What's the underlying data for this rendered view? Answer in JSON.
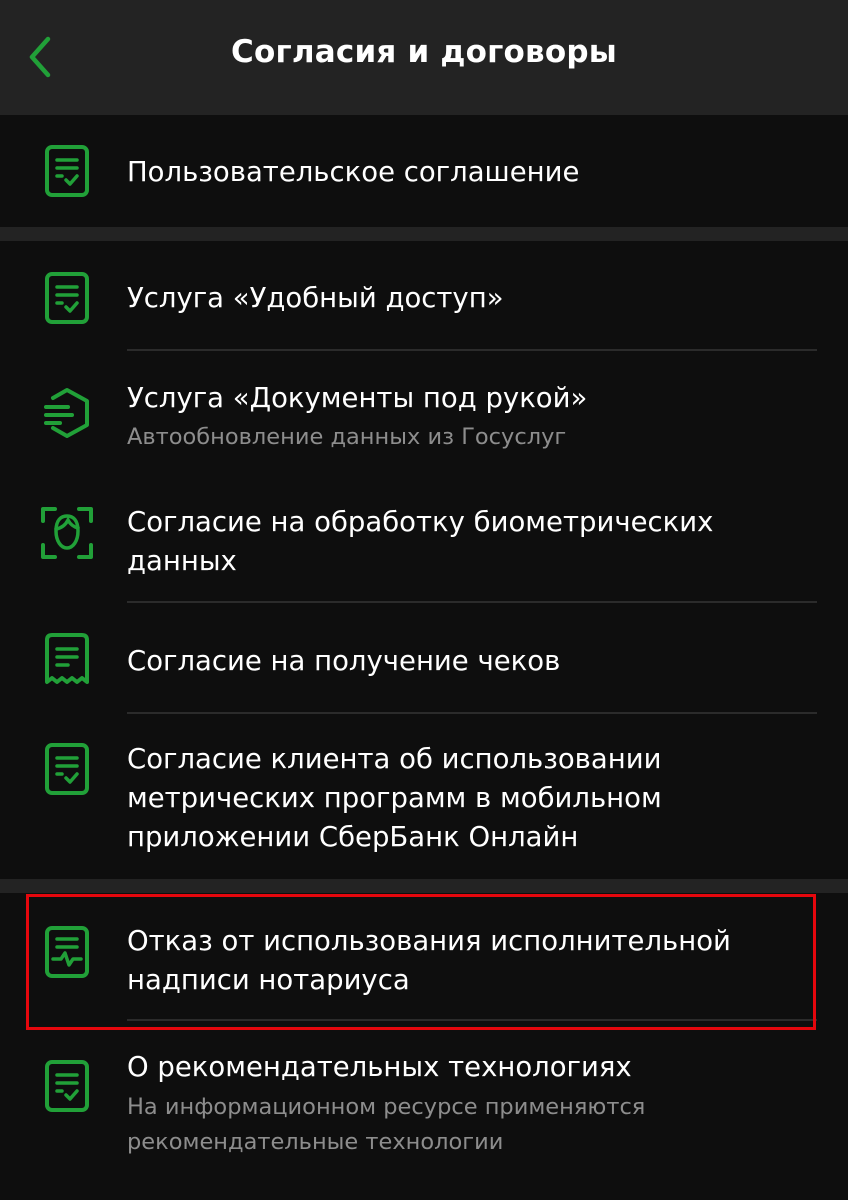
{
  "header": {
    "title": "Согласия и договоры",
    "back_icon": "chevron-left-icon",
    "accent": "#21a038"
  },
  "sections": [
    {
      "items": [
        {
          "label": "Пользовательское соглашение",
          "icon": "document-check-icon"
        }
      ]
    },
    {
      "items": [
        {
          "label": "Услуга «Удобный доступ»",
          "icon": "document-check-icon"
        },
        {
          "label": "Услуга «Документы под рукой»",
          "subtitle": "Автообновление данных из Госуслуг",
          "icon": "gosuslugi-shield-icon"
        },
        {
          "label": "Согласие на обработку биометрических данных",
          "icon": "face-scan-icon"
        },
        {
          "label": "Согласие на получение чеков",
          "icon": "receipt-icon"
        },
        {
          "label": "Согласие клиента об использовании метрических программ в мобильном приложении СберБанк Онлайн",
          "icon": "document-check-icon"
        }
      ]
    },
    {
      "items": [
        {
          "label": "Отказ от использования исполнительной надписи нотариуса",
          "icon": "document-pulse-icon",
          "highlighted": true
        },
        {
          "label": "О рекомендательных технологиях",
          "subtitle": "На информационном ресурсе применяются рекомендательные технологии",
          "icon": "document-check-icon"
        }
      ]
    }
  ],
  "colors": {
    "background": "#232323",
    "card": "#0e0e0e",
    "divider": "#2b2b2b",
    "text": "#ffffff",
    "subtext": "#8d8d8d",
    "icon": "#21a038",
    "highlight_border": "#e5070d"
  }
}
